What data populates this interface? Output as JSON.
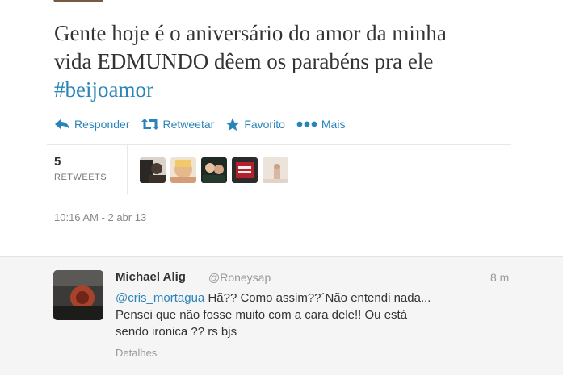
{
  "tweet": {
    "text_line1": "Gente hoje é o aniversário do amor da minha",
    "text_line2": "vida EDMUNDO dêem os parabéns pra ele",
    "hashtag": "#beijoamor",
    "actions": {
      "reply": "Responder",
      "retweet": "Retweetar",
      "favorite": "Favorito",
      "more": "Mais"
    },
    "retweet_count": "5",
    "retweet_label": "RETWEETS",
    "timestamp": "10:16 AM - 2 abr 13"
  },
  "reply": {
    "name": "Michael Alig",
    "handle": "@Roneysap",
    "time": "8 m",
    "mention": "@cris_mortagua",
    "text_after_mention": " Hã?? Como assim??´Não entendi nada...",
    "text_line2": "Pensei que não fosse muito com a cara dele!! Ou está",
    "text_line3": "sendo ironica ?? rs bjs",
    "details": "Detalhes"
  },
  "colors": {
    "link": "#2a84b9",
    "muted": "#999999",
    "reply_bg": "#f5f5f5"
  },
  "icons": [
    "reply-arrow-icon",
    "retweet-icon",
    "star-icon",
    "more-dots-icon"
  ]
}
